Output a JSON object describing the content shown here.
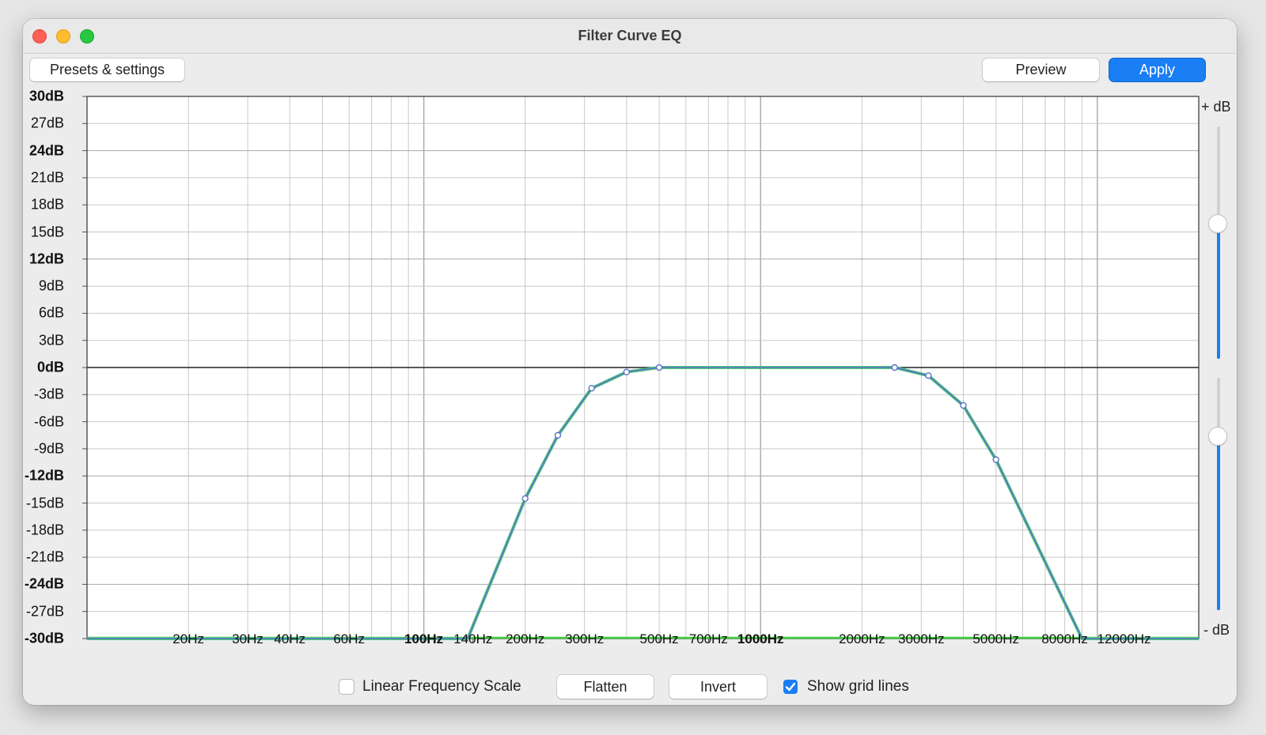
{
  "window": {
    "title": "Filter Curve EQ"
  },
  "toolbar": {
    "presets_label": "Presets & settings",
    "preview_label": "Preview",
    "apply_label": "Apply"
  },
  "colors": {
    "accent": "#1a7ef5",
    "curve": "#5a72c9",
    "curve_fill": "#4ec77a",
    "flat_line": "#3ccf3c",
    "grid": "#c8c8c8"
  },
  "graph": {
    "y_ticks": [
      {
        "label": "30dB",
        "value": 30,
        "bold": true
      },
      {
        "label": "27dB",
        "value": 27,
        "bold": false
      },
      {
        "label": "24dB",
        "value": 24,
        "bold": true
      },
      {
        "label": "21dB",
        "value": 21,
        "bold": false
      },
      {
        "label": "18dB",
        "value": 18,
        "bold": false
      },
      {
        "label": "15dB",
        "value": 15,
        "bold": false
      },
      {
        "label": "12dB",
        "value": 12,
        "bold": true
      },
      {
        "label": "9dB",
        "value": 9,
        "bold": false
      },
      {
        "label": "6dB",
        "value": 6,
        "bold": false
      },
      {
        "label": "3dB",
        "value": 3,
        "bold": false
      },
      {
        "label": "0dB",
        "value": 0,
        "bold": true
      },
      {
        "label": "-3dB",
        "value": -3,
        "bold": false
      },
      {
        "label": "-6dB",
        "value": -6,
        "bold": false
      },
      {
        "label": "-9dB",
        "value": -9,
        "bold": false
      },
      {
        "label": "-12dB",
        "value": -12,
        "bold": true
      },
      {
        "label": "-15dB",
        "value": -15,
        "bold": false
      },
      {
        "label": "-18dB",
        "value": -18,
        "bold": false
      },
      {
        "label": "-21dB",
        "value": -21,
        "bold": false
      },
      {
        "label": "-24dB",
        "value": -24,
        "bold": true
      },
      {
        "label": "-27dB",
        "value": -27,
        "bold": false
      },
      {
        "label": "-30dB",
        "value": -30,
        "bold": true
      }
    ],
    "x_ticks": [
      {
        "label": "20Hz",
        "value": 20,
        "bold": false
      },
      {
        "label": "30Hz",
        "value": 30,
        "bold": false
      },
      {
        "label": "40Hz",
        "value": 40,
        "bold": false
      },
      {
        "label": "60Hz",
        "value": 60,
        "bold": false
      },
      {
        "label": "100Hz",
        "value": 100,
        "bold": true
      },
      {
        "label": "140Hz",
        "value": 140,
        "bold": false
      },
      {
        "label": "200Hz",
        "value": 200,
        "bold": false
      },
      {
        "label": "300Hz",
        "value": 300,
        "bold": false
      },
      {
        "label": "500Hz",
        "value": 500,
        "bold": false
      },
      {
        "label": "700Hz",
        "value": 700,
        "bold": false
      },
      {
        "label": "1000Hz",
        "value": 1000,
        "bold": true
      },
      {
        "label": "2000Hz",
        "value": 2000,
        "bold": false
      },
      {
        "label": "3000Hz",
        "value": 3000,
        "bold": false
      },
      {
        "label": "5000Hz",
        "value": 5000,
        "bold": false
      },
      {
        "label": "8000Hz",
        "value": 8000,
        "bold": false
      },
      {
        "label": "12000Hz",
        "value": 12000,
        "bold": false
      }
    ],
    "x_range_hz": [
      10,
      20000
    ],
    "y_range_db": [
      -30,
      30
    ],
    "gridlines_visible": true,
    "curve_points": [
      {
        "hz": 10,
        "db": -30
      },
      {
        "hz": 135,
        "db": -30
      },
      {
        "hz": 200,
        "db": -14.5
      },
      {
        "hz": 250,
        "db": -7.5
      },
      {
        "hz": 315,
        "db": -2.3
      },
      {
        "hz": 400,
        "db": -0.5
      },
      {
        "hz": 500,
        "db": 0
      },
      {
        "hz": 2500,
        "db": 0
      },
      {
        "hz": 3150,
        "db": -0.9
      },
      {
        "hz": 4000,
        "db": -4.2
      },
      {
        "hz": 5000,
        "db": -10.2
      },
      {
        "hz": 9000,
        "db": -30
      },
      {
        "hz": 20000,
        "db": -30
      }
    ],
    "control_points": [
      {
        "hz": 200,
        "db": -14.5
      },
      {
        "hz": 250,
        "db": -7.5
      },
      {
        "hz": 315,
        "db": -2.3
      },
      {
        "hz": 400,
        "db": -0.5
      },
      {
        "hz": 500,
        "db": 0
      },
      {
        "hz": 2500,
        "db": 0
      },
      {
        "hz": 3150,
        "db": -0.9
      },
      {
        "hz": 4000,
        "db": -4.2
      },
      {
        "hz": 5000,
        "db": -10.2
      }
    ]
  },
  "sliders": {
    "plus_label": "+ dB",
    "minus_label": "- dB",
    "max_db": 30,
    "max_level": 0.58,
    "min_level": 0.75
  },
  "bottom": {
    "linear_scale_label": "Linear Frequency Scale",
    "linear_scale_checked": false,
    "flatten_label": "Flatten",
    "invert_label": "Invert",
    "grid_lines_label": "Show grid lines",
    "grid_lines_checked": true
  }
}
